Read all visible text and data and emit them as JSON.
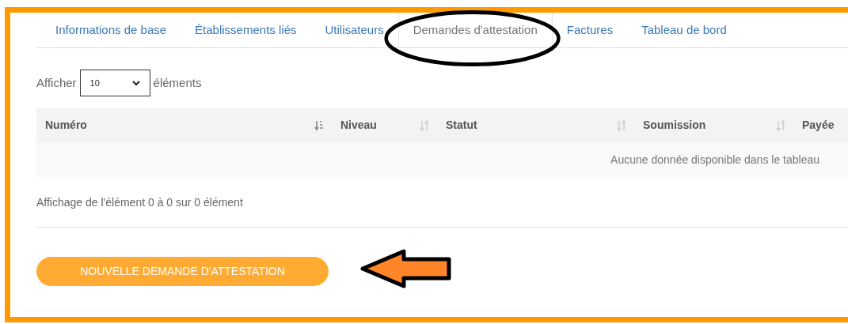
{
  "tabs": [
    {
      "label": "Informations de base",
      "selected": false
    },
    {
      "label": "Établissements liés",
      "selected": false
    },
    {
      "label": "Utilisateurs",
      "selected": false
    },
    {
      "label": "Demandes d'attestation",
      "selected": true
    },
    {
      "label": "Factures",
      "selected": false
    },
    {
      "label": "Tableau de bord",
      "selected": false
    }
  ],
  "length_menu": {
    "prefix": "Afficher",
    "value": "10",
    "suffix": "éléments"
  },
  "table": {
    "columns": [
      {
        "label": "Numéro",
        "sorted": true
      },
      {
        "label": "Niveau",
        "sorted": false
      },
      {
        "label": "Statut",
        "sorted": false
      },
      {
        "label": "Soumission",
        "sorted": false
      },
      {
        "label": "Payée"
      }
    ],
    "empty_message": "Aucune donnée disponible dans le tableau"
  },
  "info": "Affichage de l'élément 0 à 0 sur 0 élément",
  "new_button": "NOUVELLE DEMANDE D'ATTESTATION",
  "annotations": {
    "ellipse_around_tab": true,
    "arrow_to_button": true
  }
}
